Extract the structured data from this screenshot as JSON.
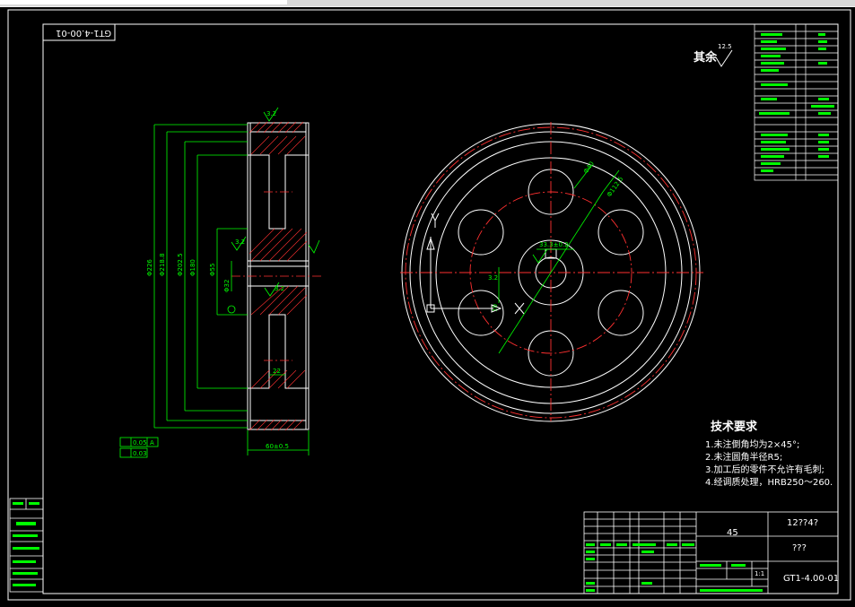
{
  "drawing": {
    "code_top": "GT1-4.00-01",
    "surface_finish_label": "其余",
    "surface_finish_value": "12.5",
    "colors": {
      "background": "#000000",
      "outline": "#ffffff",
      "dimension": "#00ff00",
      "centerline": "#ff3030",
      "hatch": "#ff3030"
    }
  },
  "tech_requirements": {
    "title": "技术要求",
    "items": [
      "1.未注倒角均为2×45°;",
      "2.未注圆角半径R5;",
      "3.加工后的零件不允许有毛刺;",
      "4.经调质处理，HRB250～260."
    ]
  },
  "title_block": {
    "material": "45",
    "code_right": "12??4?",
    "name_right": "???",
    "drawing_no": "GT1-4.00-01",
    "scale": "1:1"
  },
  "dimensions": {
    "side_view": [
      "Φ226",
      "Φ218.8",
      "Φ202.5",
      "Φ180",
      "Φ55",
      "Φ32",
      "60±0.5",
      "3.2",
      "3.2",
      "3.2",
      "22"
    ],
    "gdt": [
      "0.05",
      "A",
      "0.03"
    ],
    "front_view": [
      "Φ40",
      "Φ112.5",
      "33.3±0.2",
      "3.2",
      "10"
    ]
  }
}
